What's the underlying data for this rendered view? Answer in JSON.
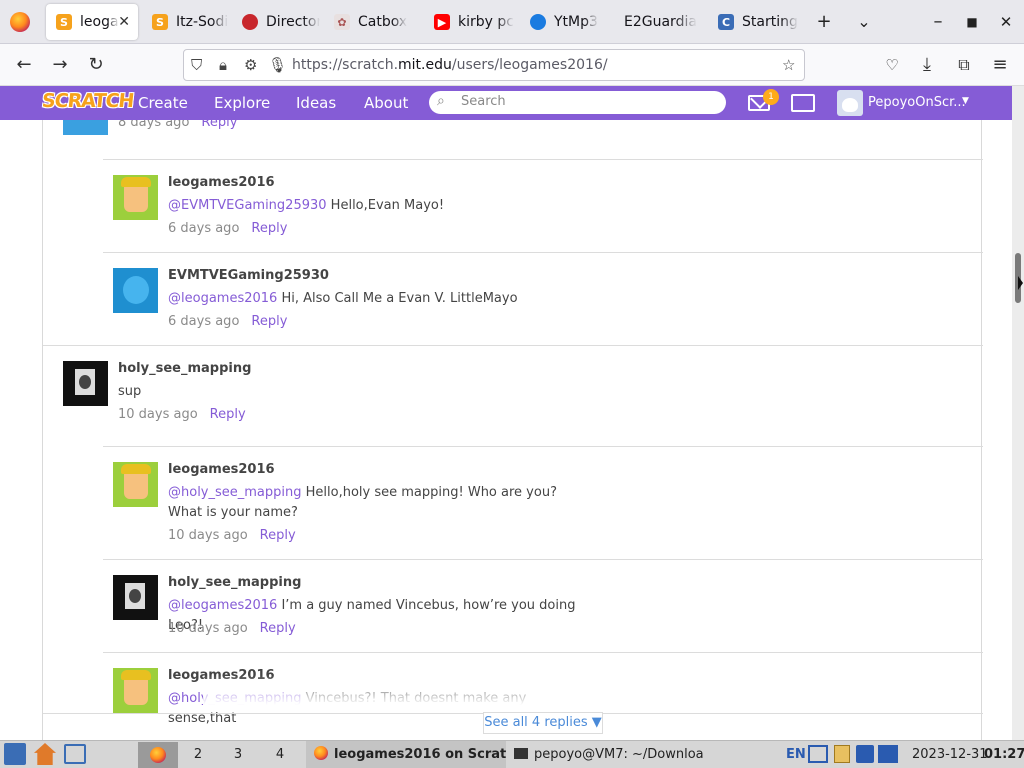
{
  "browser": {
    "tabs": [
      {
        "label": "leoga",
        "active": true,
        "favicon": "scratch-favicon",
        "color": "#f6a21c"
      },
      {
        "label": "Itz-Sodi",
        "favicon": "scratch-favicon",
        "color": "#f6a21c"
      },
      {
        "label": "Director",
        "favicon": "maple-leaf-favicon",
        "color": "#c8262c"
      },
      {
        "label": "Catbox",
        "favicon": "cat-favicon",
        "color": "#caa"
      },
      {
        "label": "kirby pc",
        "favicon": "youtube-favicon",
        "color": "#ff0000"
      },
      {
        "label": "YtMp3",
        "favicon": "ytmp3-favicon",
        "color": "#1a7be0"
      },
      {
        "label": "E2Guardia",
        "favicon": "none",
        "color": "#e8e8ed"
      },
      {
        "label": "Starting",
        "favicon": "c-favicon",
        "color": "#3a6cb6"
      }
    ],
    "new_tab_glyph": "+",
    "tab_list_glyph": "⌄",
    "url_prefix": "https://scratch.",
    "url_domain": "mit.edu",
    "url_path": "/users/leogames2016/"
  },
  "scratch_nav": {
    "logo": "SCRATCH",
    "links": [
      "Create",
      "Explore",
      "Ideas",
      "About"
    ],
    "search_placeholder": "Search",
    "messages_count": "1",
    "username": "PepoyoOnScr..."
  },
  "comments": [
    {
      "avatar": "blue",
      "name": "",
      "text": "",
      "time": "8 days ago",
      "reply": "Reply"
    },
    {
      "avatar": "leo",
      "name": "leogames2016",
      "mention": "@EVMTVEGaming25930",
      "text": " Hello,Evan Mayo!",
      "time": "6 days ago",
      "reply": "Reply"
    },
    {
      "avatar": "evm",
      "name": "EVMTVEGaming25930",
      "mention": "@leogames2016",
      "text": " Hi, Also Call Me a Evan V. LittleMayo",
      "time": "6 days ago",
      "reply": "Reply"
    },
    {
      "avatar": "holy",
      "name": "holy_see_mapping",
      "mention": "",
      "text": "sup",
      "time": "10 days ago",
      "reply": "Reply"
    },
    {
      "avatar": "leo",
      "name": "leogames2016",
      "mention": "@holy_see_mapping",
      "text": " Hello,holy see mapping! Who are you? What is your name?",
      "time": "10 days ago",
      "reply": "Reply"
    },
    {
      "avatar": "holy",
      "name": "holy_see_mapping",
      "mention": "@leogames2016",
      "text": " I’m a guy named Vincebus, how’re you doing Leo?!",
      "time": "10 days ago",
      "reply": "Reply"
    },
    {
      "avatar": "leo",
      "name": "leogames2016",
      "mention": "@holy_see_mapping",
      "text": " Vincebus?! That doesnt make any sense,that",
      "time": "",
      "reply": ""
    }
  ],
  "see_all": "See all 4 replies ▼",
  "taskbar": {
    "workspaces": [
      "2",
      "3",
      "4"
    ],
    "window_1": "leogames2016 on Scrat",
    "window_2": "pepoyo@VM7: ~/Downloa",
    "lang": "EN",
    "date": "2023-12-31",
    "time": "01:27"
  }
}
